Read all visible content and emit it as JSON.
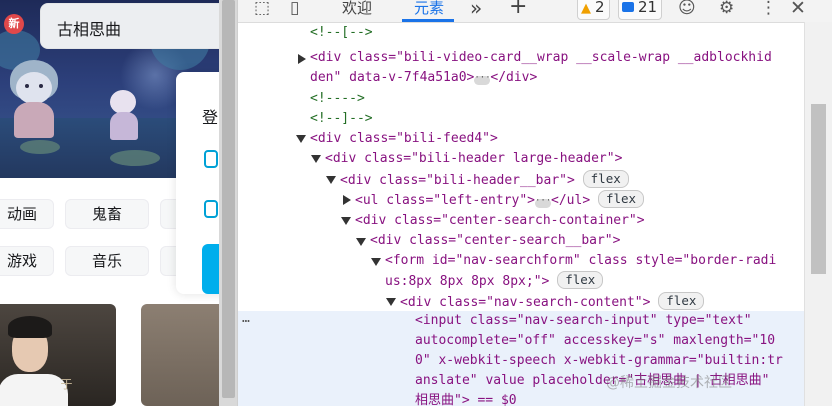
{
  "page": {
    "new_badge": "新",
    "search_text": "古相思曲",
    "panel": {
      "login_label": "登"
    },
    "chips": [
      {
        "label": "动画"
      },
      {
        "label": "鬼畜"
      },
      {
        "label": "游戏"
      },
      {
        "label": "音乐"
      }
    ],
    "thumb_tag": "于"
  },
  "devtools": {
    "tabs": {
      "welcome": "欢迎",
      "elements": "元素",
      "more": "»",
      "add": "+"
    },
    "warnings_count": "2",
    "messages_count": "21",
    "lines": [
      {
        "t": "<!--[-->"
      },
      {
        "t": "<div class=\"bili-video-card__wrap __scale-wrap __adblockhid"
      },
      {
        "t": "den\" data-v-7f4a51a0>"
      },
      {
        "t": "<!---->"
      },
      {
        "t": "<!--]-->"
      },
      {
        "t": "<div class=\"bili-feed4\">"
      },
      {
        "t": "<div class=\"bili-header large-header\">"
      },
      {
        "t": "<div class=\"bili-header__bar\">"
      },
      {
        "t": "<ul class=\"left-entry\">"
      },
      {
        "t": "<div class=\"center-search-container\">"
      },
      {
        "t": "<div class=\"center-search__bar\">"
      },
      {
        "t": "<form id=\"nav-searchform\" class style=\"border-radi"
      },
      {
        "t": "us:8px 8px 8px 8px;\">"
      },
      {
        "t": "<div class=\"nav-search-content\">"
      }
    ],
    "selected": {
      "ellipsis": "…",
      "l1": "<input class=\"nav-search-input\" type=\"text\"",
      "l2": "autocomplete=\"off\" accesskey=\"s\" maxlength=\"10",
      "l3": "0\" x-webkit-speech x-webkit-grammar=\"builtin:tr",
      "l4": "anslate\" value placeholder=\"古相思曲 | 古相思曲\"",
      "l5": "相思曲\"> == $0"
    },
    "flex_label": "flex",
    "close_div": "</div>",
    "close_ul": "</ul>",
    "watermark": "@稀土掘金技术社区"
  },
  "colors": {
    "tag": "#881280",
    "attr_name": "#994500",
    "attr_value": "#1a1aa6",
    "comment": "#236e25",
    "active_tab": "#1a73e8"
  }
}
